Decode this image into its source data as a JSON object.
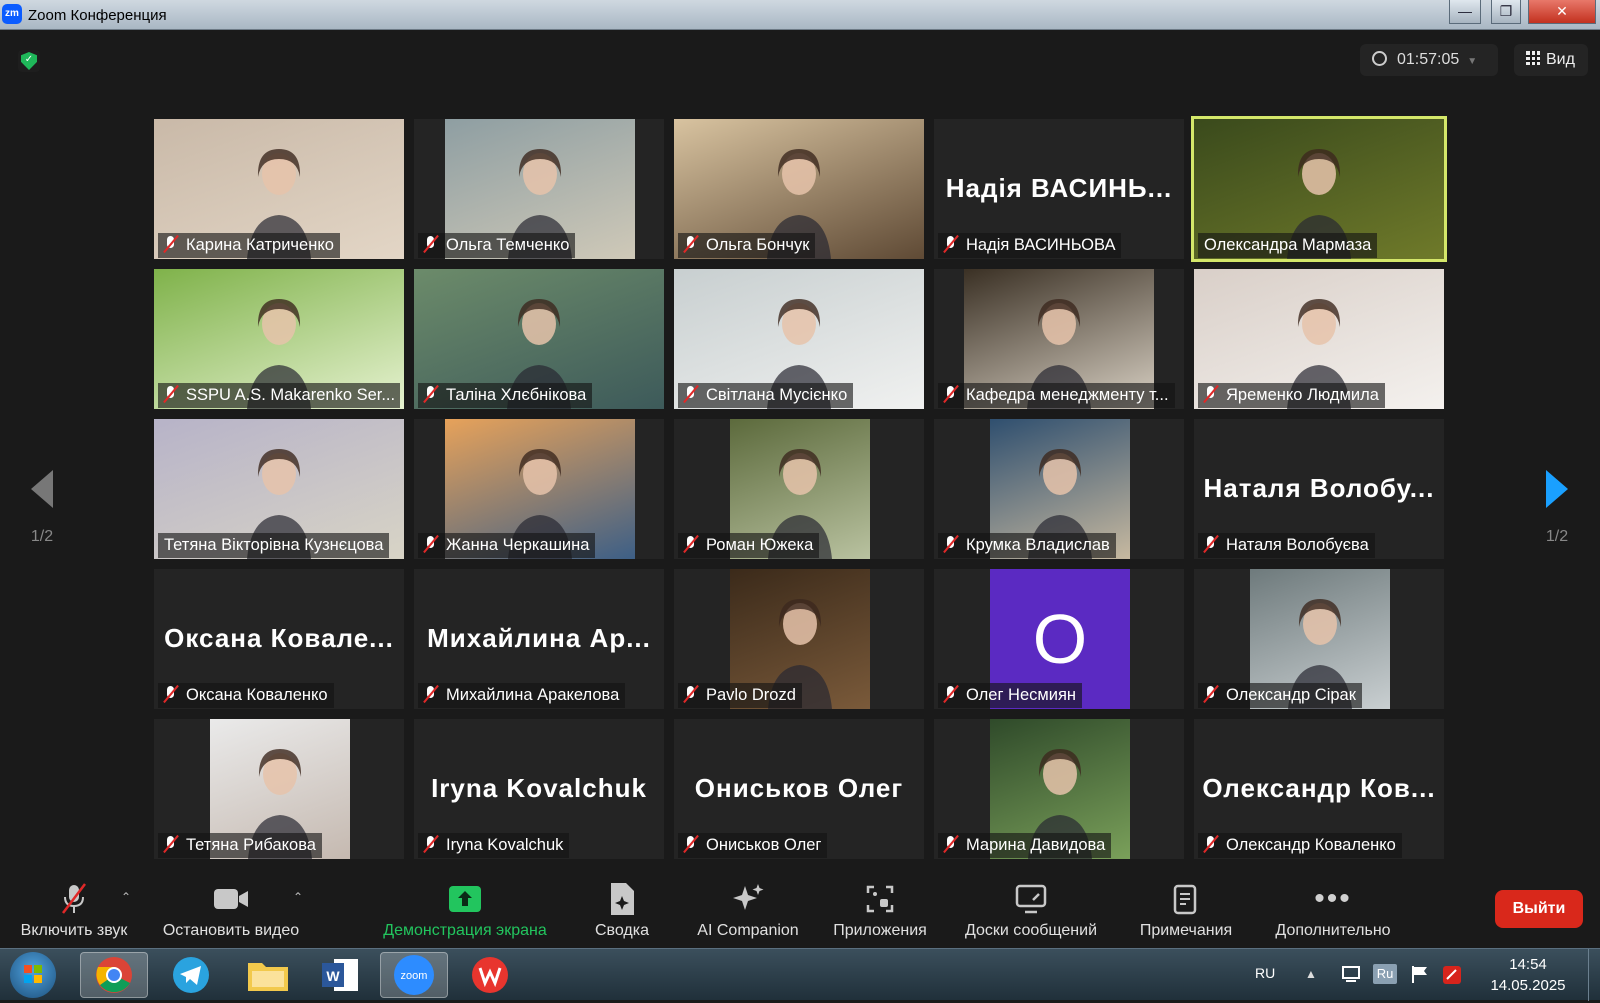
{
  "window": {
    "title": "Zoom Конференция"
  },
  "header": {
    "timer": "01:57:05",
    "view_label": "Вид"
  },
  "pager": {
    "left": "1/2",
    "right": "1/2"
  },
  "participants": [
    {
      "name": "Карина Катриченко",
      "muted": true,
      "type": "video"
    },
    {
      "name": "Ольга Темченко",
      "muted": true,
      "type": "video"
    },
    {
      "name": "Ольга Бончук",
      "muted": true,
      "type": "video"
    },
    {
      "name": "Надія ВАСИНЬОВА",
      "display": "Надія ВАСИНЬ...",
      "muted": true,
      "type": "name"
    },
    {
      "name": "Олександра Мармаза",
      "muted": false,
      "type": "video",
      "active": true
    },
    {
      "name": "SSPU A.S. Makarenko Ser...",
      "muted": true,
      "type": "video"
    },
    {
      "name": "Таліна Хлєбнікова",
      "muted": true,
      "type": "video"
    },
    {
      "name": "Світлана Мусієнко",
      "muted": true,
      "type": "video"
    },
    {
      "name": "Кафедра менеджменту т...",
      "muted": true,
      "type": "video"
    },
    {
      "name": "Яременко Людмила",
      "muted": true,
      "type": "video"
    },
    {
      "name": "Тетяна Вікторівна Кузнєцова",
      "muted": false,
      "type": "video"
    },
    {
      "name": "Жанна Черкашина",
      "muted": true,
      "type": "video"
    },
    {
      "name": "Роман Южека",
      "muted": true,
      "type": "video"
    },
    {
      "name": "Крумка Владислав",
      "muted": true,
      "type": "video"
    },
    {
      "name": "Наталя Волобуєва",
      "display": "Наталя Волобу...",
      "muted": true,
      "type": "name"
    },
    {
      "name": "Оксана Коваленко",
      "display": "Оксана Ковале...",
      "muted": true,
      "type": "name"
    },
    {
      "name": "Михайлина Аракелова",
      "display": "Михайлина Ар...",
      "muted": true,
      "type": "name"
    },
    {
      "name": "Pavlo Drozd",
      "muted": true,
      "type": "video"
    },
    {
      "name": "Олег Несмиян",
      "display": "О",
      "muted": true,
      "type": "avatar"
    },
    {
      "name": "Олександр Сірак",
      "muted": true,
      "type": "video"
    },
    {
      "name": "Тетяна Рибакова",
      "muted": true,
      "type": "video"
    },
    {
      "name": "Iryna Kovalchuk",
      "display": "Iryna Kovalchuk",
      "muted": true,
      "type": "name"
    },
    {
      "name": "Ониськов Олег",
      "display": "Ониськов Олег",
      "muted": true,
      "type": "name"
    },
    {
      "name": "Марина Давидова",
      "muted": true,
      "type": "video"
    },
    {
      "name": "Олександр Коваленко",
      "display": "Олександр Ков...",
      "muted": true,
      "type": "name"
    }
  ],
  "toolbar": {
    "unmute": "Включить звук",
    "stop_video": "Остановить видео",
    "share": "Демонстрация экрана",
    "summary": "Сводка",
    "ai": "AI Companion",
    "apps": "Приложения",
    "whiteboards": "Доски сообщений",
    "notes": "Примечания",
    "more": "Дополнительно",
    "leave": "Выйти"
  },
  "taskbar": {
    "lang": "RU",
    "time": "14:54",
    "date": "14.05.2025",
    "lang_badge": "Ru",
    "zoom_label": "zoom"
  },
  "colors": {
    "accent_green": "#22c55e",
    "leave_red": "#d9281b",
    "active_speaker": "#d4e76a",
    "next_arrow": "#1aa0ff"
  }
}
